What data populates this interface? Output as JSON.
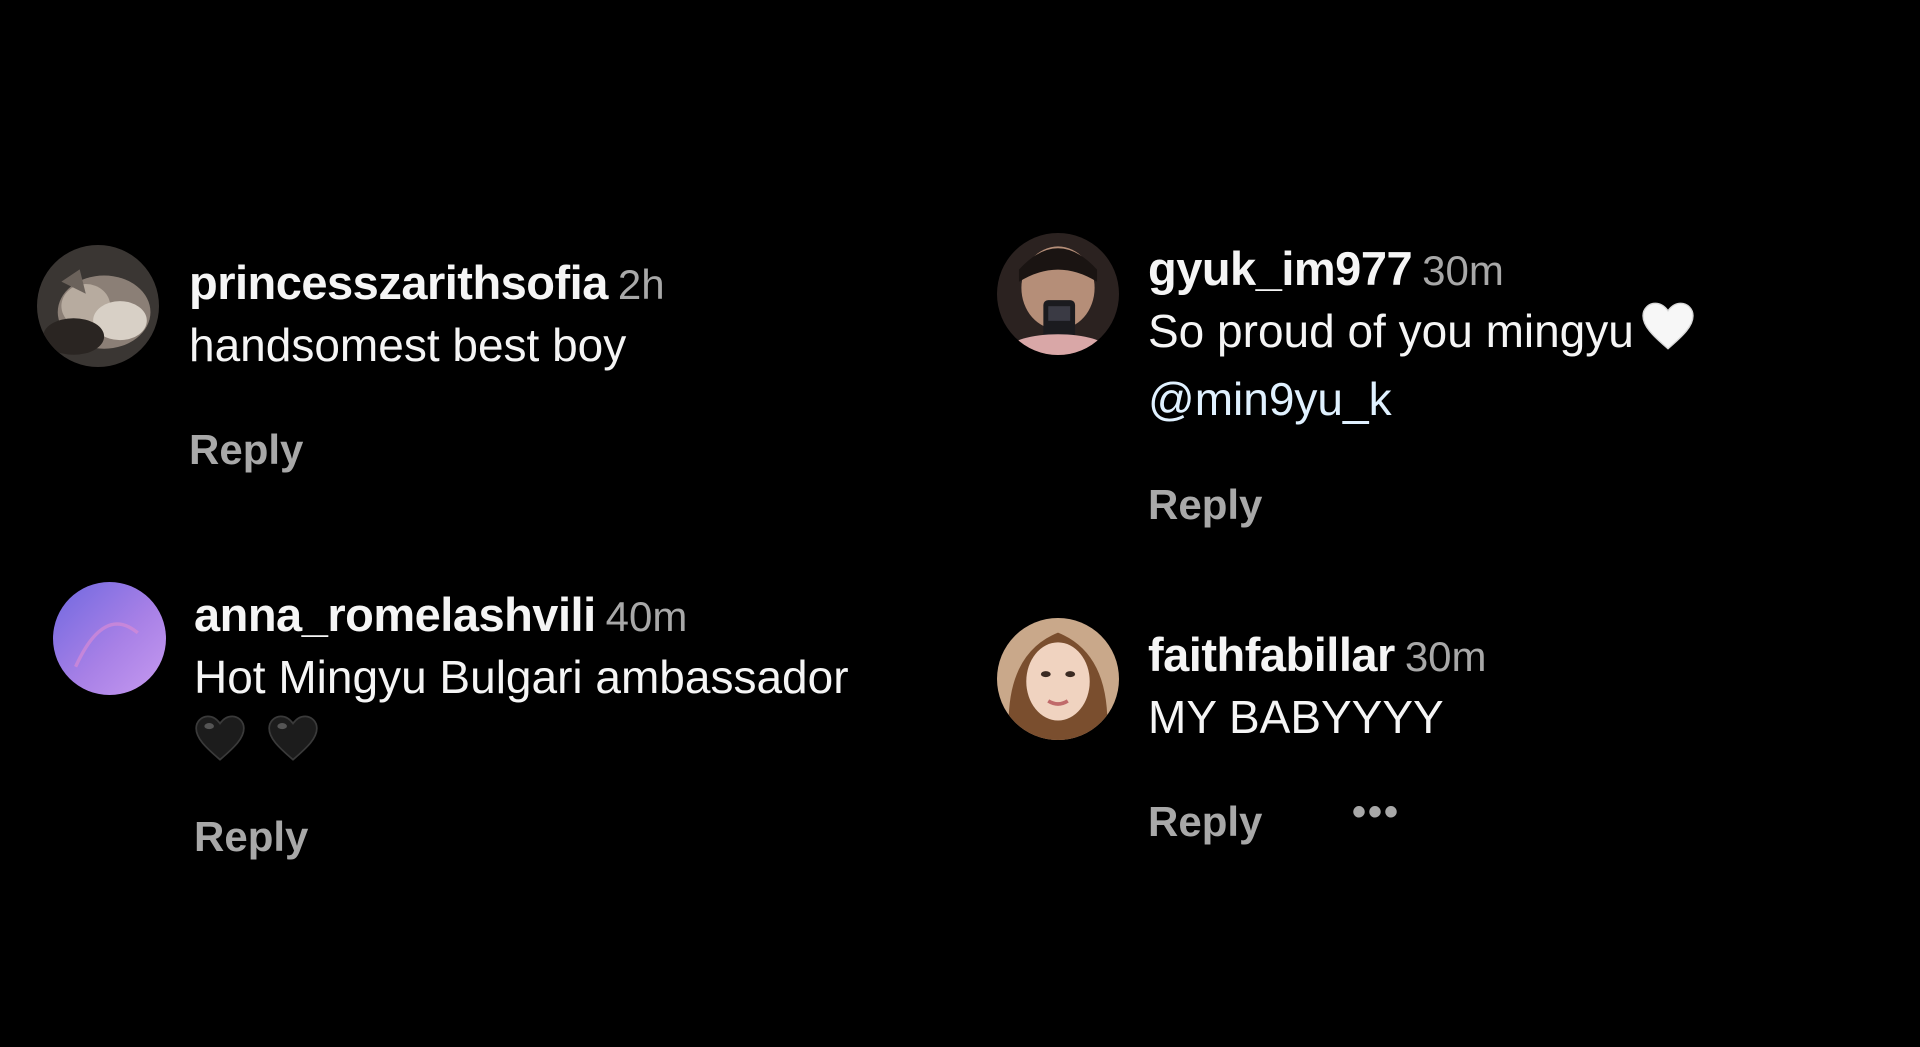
{
  "comments": [
    {
      "username": "princesszarithsofia",
      "time": "2h",
      "text": "handsomest best boy",
      "reply_label": "Reply"
    },
    {
      "username": "anna_romelashvili",
      "time": "40m",
      "text": "Hot Mingyu Bulgari ambassador",
      "emojis": [
        "black-heart",
        "black-heart"
      ],
      "reply_label": "Reply"
    },
    {
      "username": "gyuk_im977",
      "time": "30m",
      "text": "So proud of you mingyu",
      "emoji": "white-heart",
      "mention": "@min9yu_k",
      "reply_label": "Reply"
    },
    {
      "username": "faithfabillar",
      "time": "30m",
      "text": "MY BABYYYY",
      "reply_label": "Reply",
      "more_label": "•••"
    }
  ],
  "colors": {
    "background": "#000000",
    "primary_text": "#f5f5f5",
    "secondary_text": "#a8a8a8",
    "mention": "#e0f1ff"
  }
}
